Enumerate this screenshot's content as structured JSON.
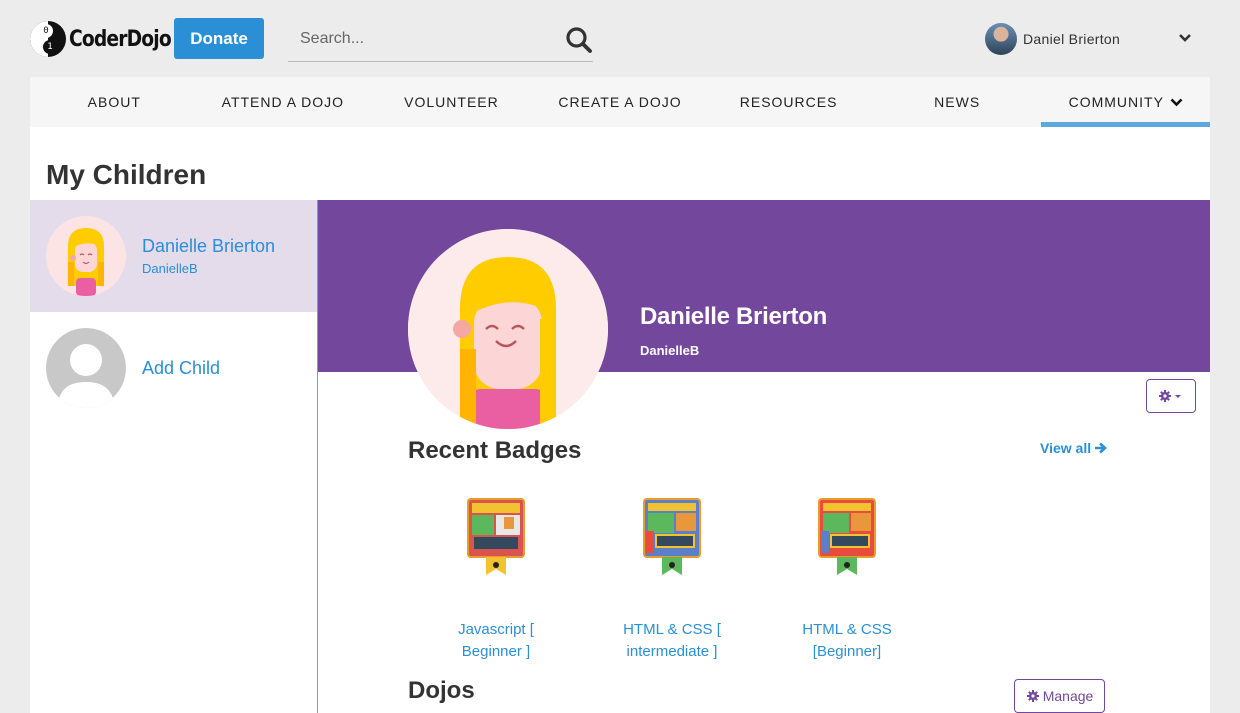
{
  "header": {
    "logo_text": "CoderDojo",
    "donate_label": "Donate",
    "search_placeholder": "Search...",
    "user_name": "Daniel Brierton"
  },
  "nav": {
    "items": [
      {
        "label": "ABOUT"
      },
      {
        "label": "ATTEND A DOJO"
      },
      {
        "label": "VOLUNTEER"
      },
      {
        "label": "CREATE A DOJO"
      },
      {
        "label": "RESOURCES"
      },
      {
        "label": "NEWS"
      },
      {
        "label": "COMMUNITY",
        "active": true
      }
    ]
  },
  "page": {
    "title": "My Children"
  },
  "sidebar": {
    "children": [
      {
        "name": "Danielle Brierton",
        "username": "DanielleB",
        "selected": true
      }
    ],
    "add_child_label": "Add Child"
  },
  "profile": {
    "name": "Danielle Brierton",
    "username": "DanielleB"
  },
  "badges": {
    "title": "Recent Badges",
    "view_all_label": "View all",
    "items": [
      {
        "label": "Javascript [ Beginner ]"
      },
      {
        "label": "HTML & CSS [ intermediate ]"
      },
      {
        "label": "HTML & CSS [Beginner]"
      }
    ]
  },
  "dojos": {
    "title": "Dojos",
    "manage_label": "Manage"
  },
  "colors": {
    "accent_blue": "#2a8fd5",
    "brand_purple": "#73479c",
    "selected_bg": "#e4dbeb"
  }
}
